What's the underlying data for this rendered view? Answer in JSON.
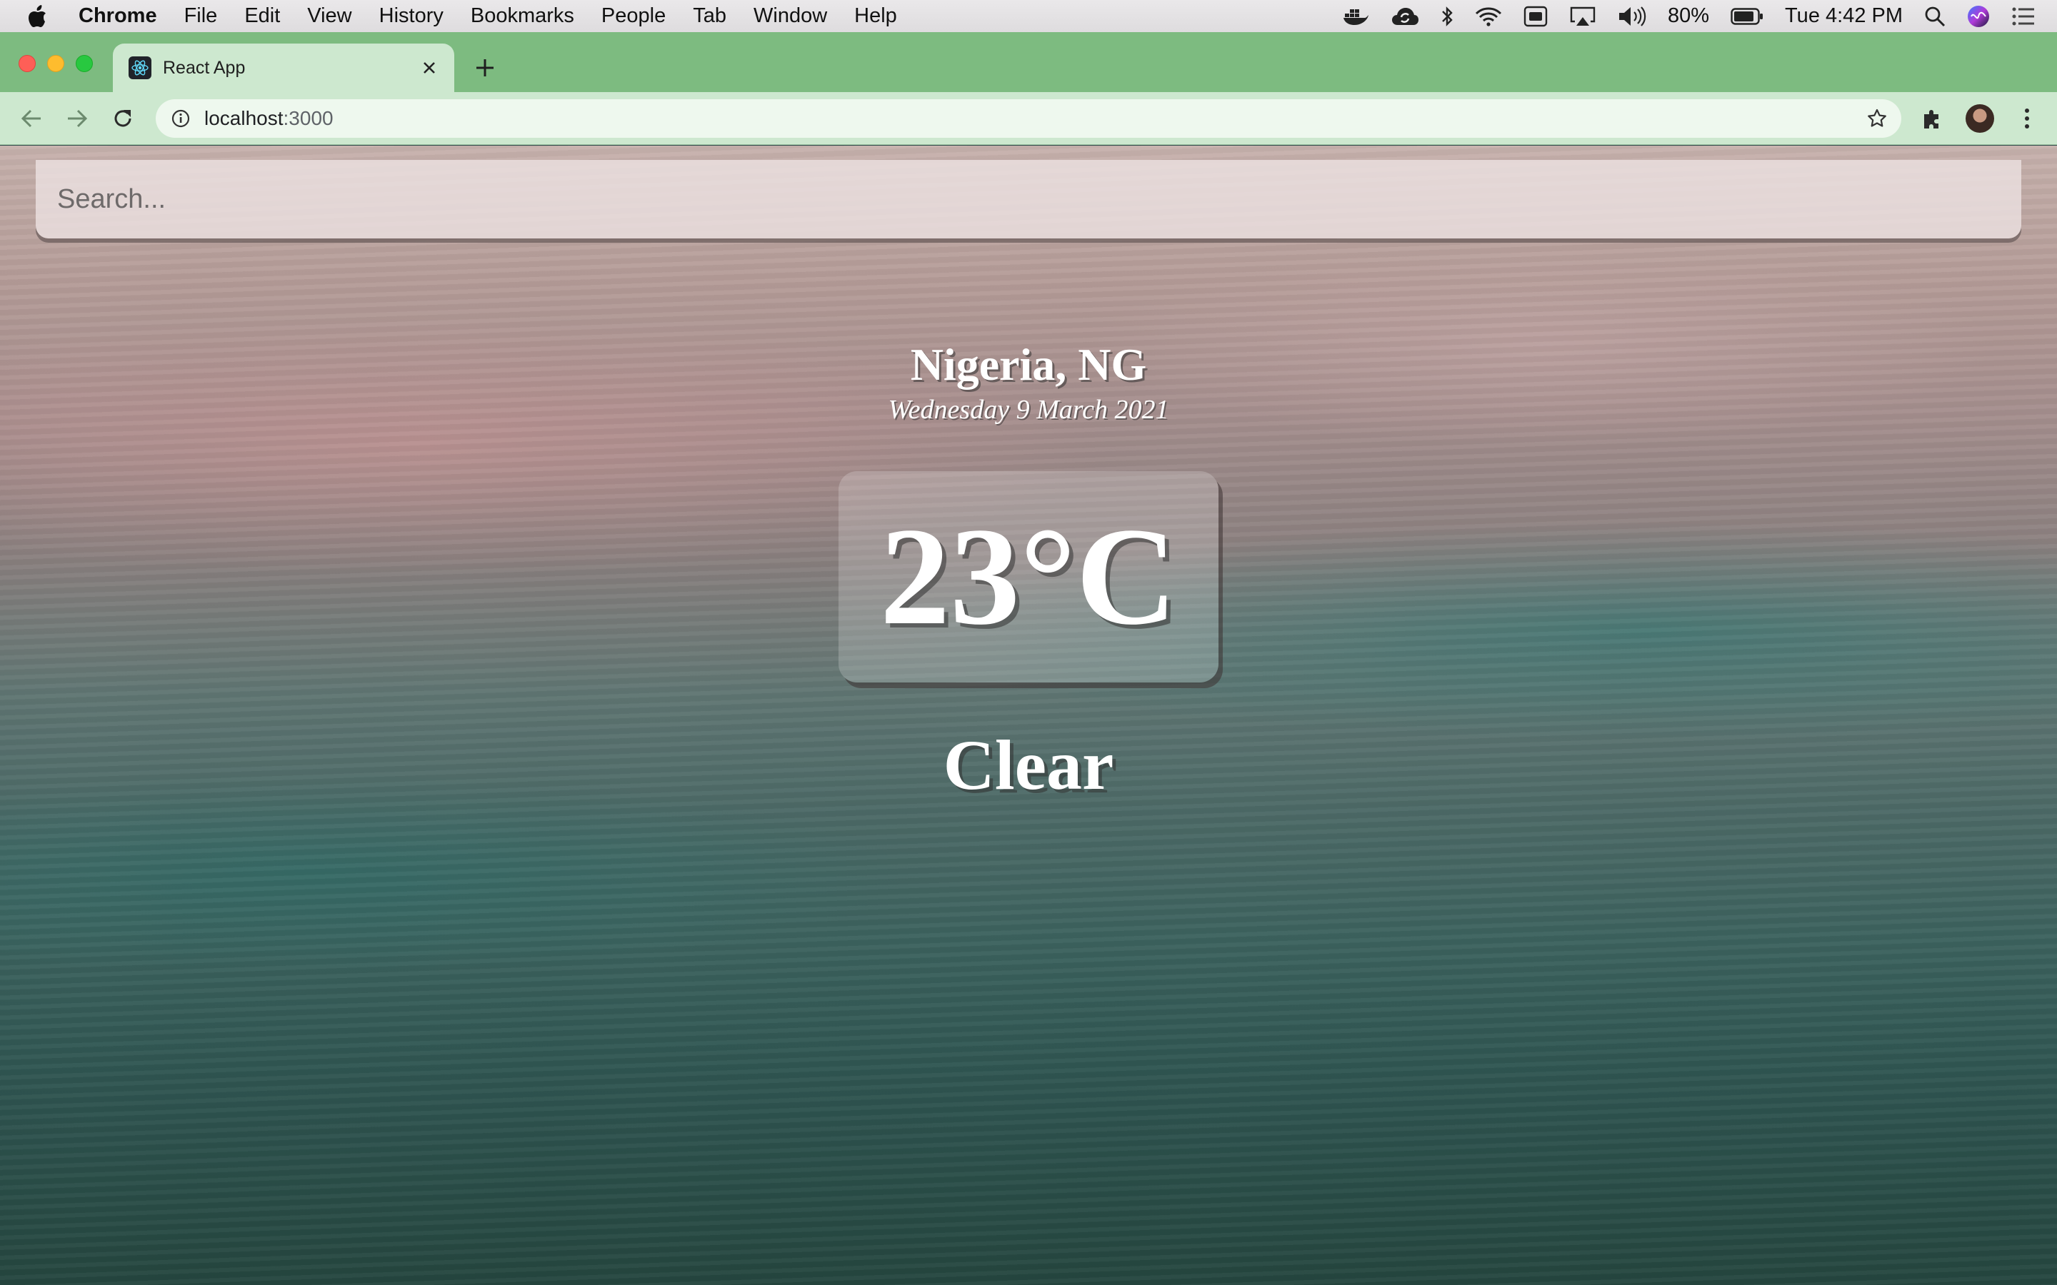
{
  "menubar": {
    "app_name": "Chrome",
    "items": [
      "File",
      "Edit",
      "View",
      "History",
      "Bookmarks",
      "People",
      "Tab",
      "Window",
      "Help"
    ],
    "battery": "80%",
    "clock": "Tue 4:42 PM",
    "status_icons": [
      "docker-icon",
      "cloud-sync-icon",
      "bluetooth-icon",
      "wifi-icon",
      "keyboard-input-icon",
      "airplay-icon",
      "volume-icon",
      "battery-icon",
      "spotlight-search-icon",
      "siri-icon",
      "notification-center-icon"
    ]
  },
  "browser": {
    "tab_title": "React App",
    "url_host": "localhost",
    "url_port": ":3000",
    "tab_color": "#7dbb80",
    "toolbar_color": "#cde8cf"
  },
  "page": {
    "search_placeholder": "Search...",
    "location": "Nigeria, NG",
    "date": "Wednesday 9 March 2021",
    "temperature": "23°C",
    "condition": "Clear"
  }
}
